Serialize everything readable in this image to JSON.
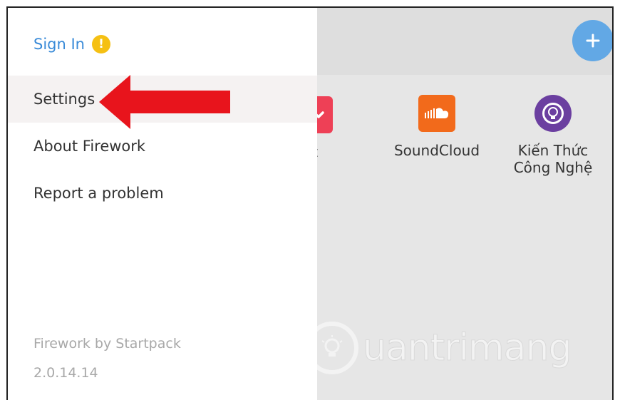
{
  "side_menu": {
    "sign_in_label": "Sign In",
    "warning_glyph": "!",
    "items": [
      {
        "label": "Settings",
        "highlighted": true
      },
      {
        "label": "About Firework",
        "highlighted": false
      },
      {
        "label": "Report a problem",
        "highlighted": false
      }
    ],
    "footer": {
      "product": "Firework by Startpack",
      "version": "2.0.14.14"
    }
  },
  "background_apps": {
    "add_button_icon": "plus-icon",
    "tiles": [
      {
        "label": "ket",
        "icon": "pocket-icon",
        "color": "#ee4056"
      },
      {
        "label": "SoundCloud",
        "icon": "soundcloud-icon",
        "color": "#f26a1b"
      },
      {
        "label": "Kiến Thức Công Nghệ",
        "icon": "lightbulb-icon",
        "color": "#6b3fa0"
      }
    ]
  },
  "annotation": {
    "arrow_color": "#e8141c",
    "arrow_target": "Settings"
  },
  "watermark": {
    "text": "uantrimang",
    "icon": "lightbulb-icon"
  },
  "colors": {
    "sign_in": "#3a8bd8",
    "warning": "#f5c013",
    "add_button": "#62a8e5"
  }
}
